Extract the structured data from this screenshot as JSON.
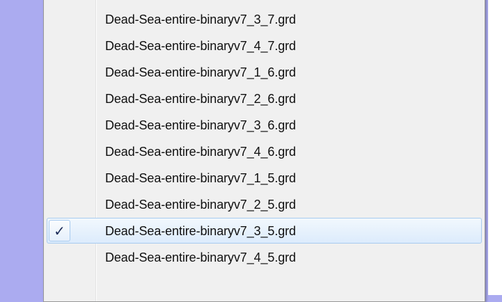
{
  "menu": {
    "items": [
      {
        "label": "Dead-Sea-entire-binaryv7_3_7.grd",
        "checked": false
      },
      {
        "label": "Dead-Sea-entire-binaryv7_4_7.grd",
        "checked": false
      },
      {
        "label": "Dead-Sea-entire-binaryv7_1_6.grd",
        "checked": false
      },
      {
        "label": "Dead-Sea-entire-binaryv7_2_6.grd",
        "checked": false
      },
      {
        "label": "Dead-Sea-entire-binaryv7_3_6.grd",
        "checked": false
      },
      {
        "label": "Dead-Sea-entire-binaryv7_4_6.grd",
        "checked": false
      },
      {
        "label": "Dead-Sea-entire-binaryv7_1_5.grd",
        "checked": false
      },
      {
        "label": "Dead-Sea-entire-binaryv7_2_5.grd",
        "checked": false
      },
      {
        "label": "Dead-Sea-entire-binaryv7_3_5.grd",
        "checked": true
      },
      {
        "label": "Dead-Sea-entire-binaryv7_4_5.grd",
        "checked": false
      }
    ],
    "check_glyph": "✓",
    "check_icon": "checkmark-icon"
  },
  "colors": {
    "desktop": "#ababf0",
    "menu_bg": "#f0f0f0",
    "highlight_border": "#a8cbef"
  }
}
